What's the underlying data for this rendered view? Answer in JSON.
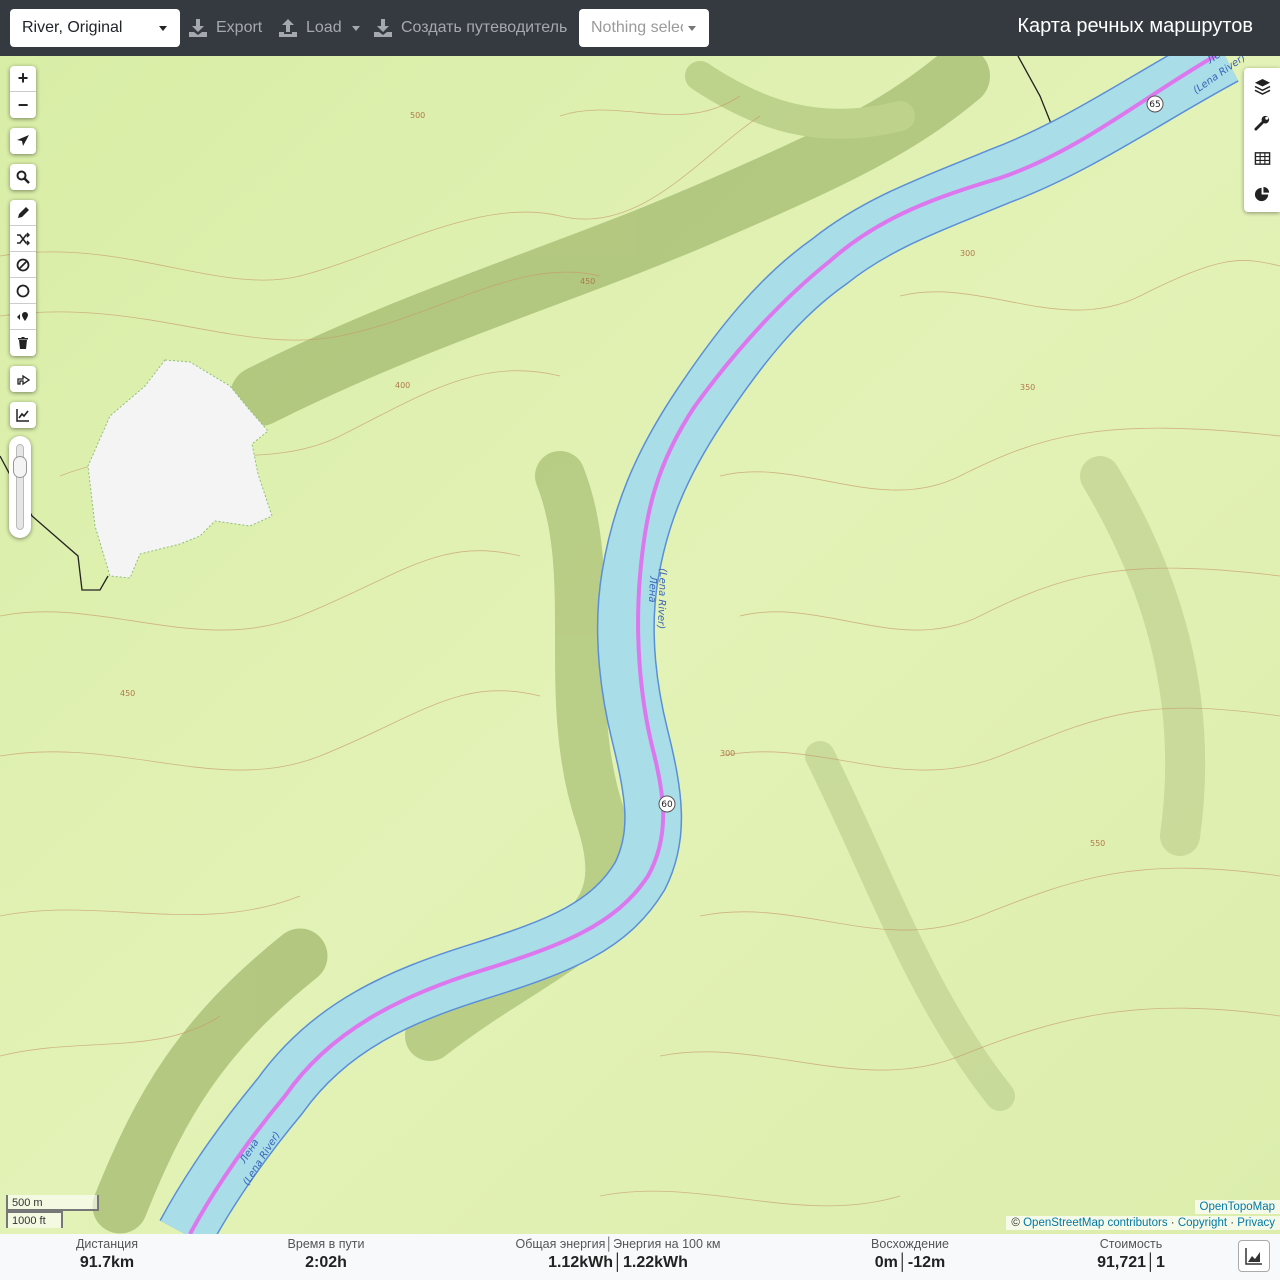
{
  "navbar": {
    "profile_select": "River, Original",
    "export_label": "Export",
    "load_label": "Load",
    "guide_label": "Создать путеводитель",
    "route_select_placeholder": "Nothing selected",
    "app_title": "Карта речных маршрутов"
  },
  "map": {
    "river_label_primary": "Лена",
    "river_label_secondary": "(Lena River)",
    "km_markers": [
      "65",
      "60"
    ],
    "contour_labels": [
      "500",
      "450",
      "400",
      "350",
      "300",
      "550"
    ],
    "scale_metric": "500 m",
    "scale_imperial": "1000 ft",
    "attribution_layer": "OpenTopoMap",
    "attribution_prefix": "©",
    "attribution_osm": "OpenStreetMap contributors",
    "attribution_sep1": "·",
    "attribution_copyright": "Copyright",
    "attribution_sep2": "·",
    "attribution_privacy": "Privacy",
    "colors": {
      "river": "#a9dde8",
      "route": "#dd77ee",
      "terrain": "#dff0b0",
      "shadow": "#8fa85a"
    }
  },
  "left_controls": {
    "zoom_in": "+",
    "zoom_out": "−",
    "icons": [
      "locate-icon",
      "search-icon",
      "draw-icon",
      "shuffle-icon",
      "no-go-icon",
      "circle-icon",
      "poi-icon",
      "delete-icon",
      "reverse-icon",
      "elevation-icon"
    ]
  },
  "right_controls": {
    "icons": [
      "layers-icon",
      "settings-icon",
      "table-icon",
      "pie-chart-icon"
    ]
  },
  "stats": {
    "distance": {
      "label": "Дистанция",
      "value": "91.7",
      "unit": "km"
    },
    "time": {
      "label": "Время в пути",
      "value": "2:02",
      "unit": "h"
    },
    "energy": {
      "label": "Общая энергия│Энергия на 100 км",
      "value1": "1.12",
      "unit1": "kWh",
      "sep": "│",
      "value2": "1.22",
      "unit2": "kWh"
    },
    "ascent": {
      "label": "Восхождение",
      "value1": "0",
      "unit1": "m",
      "sep": "│",
      "value2": "-12",
      "unit2": "m"
    },
    "cost": {
      "label": "Стоимость",
      "value1": "91,721",
      "sep": "│",
      "value2": "1"
    }
  }
}
